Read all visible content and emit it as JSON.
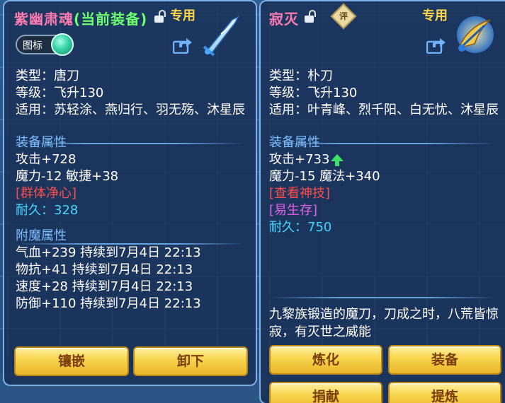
{
  "left": {
    "title": "紫幽肃魂",
    "title_sub": "(当前装备)",
    "exclusive": "专用",
    "icon_toggle_label": "图标",
    "type": "类型：唐刀",
    "level": "等级：飞升130",
    "applies": "适用：苏轻涂、燕归行、羽无殇、沐星辰",
    "equip_attr_header": "装备属性",
    "attack": "攻击+728",
    "magic_agility": "魔力-12 敏捷+38",
    "skill": "[群体净心]",
    "durability": "耐久：328",
    "enchant_header": "附魔属性",
    "enchants": [
      "气血+239 持续到7月4日 22:13",
      "物抗+41 持续到7月4日 22:13",
      "速度+28 持续到7月4日 22:13",
      "防御+110 持续到7月4日 22:13"
    ],
    "buttons": {
      "inlay": "镶嵌",
      "unequip": "卸下"
    }
  },
  "right": {
    "title": "寂灭",
    "rate_badge": "评",
    "exclusive": "专用",
    "type": "类型：朴刀",
    "level": "等级：飞升130",
    "applies": "适用：叶青峰、烈千阳、白无忧、沐星辰",
    "equip_attr_header": "装备属性",
    "attack": "攻击+733",
    "magic_spell": "魔力-15 魔法+340",
    "view_skill": "[查看神技]",
    "fragile": "[易生存]",
    "durability": "耐久：750",
    "description": "九黎族锻造的魔刀，刀成之时，八荒皆惊寂，有灭世之威能",
    "buttons": {
      "refine": "炼化",
      "equip": "装备",
      "donate": "捐献",
      "extract": "提炼"
    }
  },
  "colors": {
    "title": "#ff7ab0",
    "current_tag": "#6dff6d",
    "exclusive": "#ffd64a",
    "section": "#7fbfff",
    "skill_red": "#ff4c4c",
    "durability": "#45d6ff",
    "fragile": "#e460e8",
    "button": "#f7d34c",
    "button_text": "#7a3d0e"
  },
  "icons": [
    "lock-icon",
    "share-icon",
    "sword-icon",
    "up-arrow-icon",
    "rate-badge-icon"
  ]
}
